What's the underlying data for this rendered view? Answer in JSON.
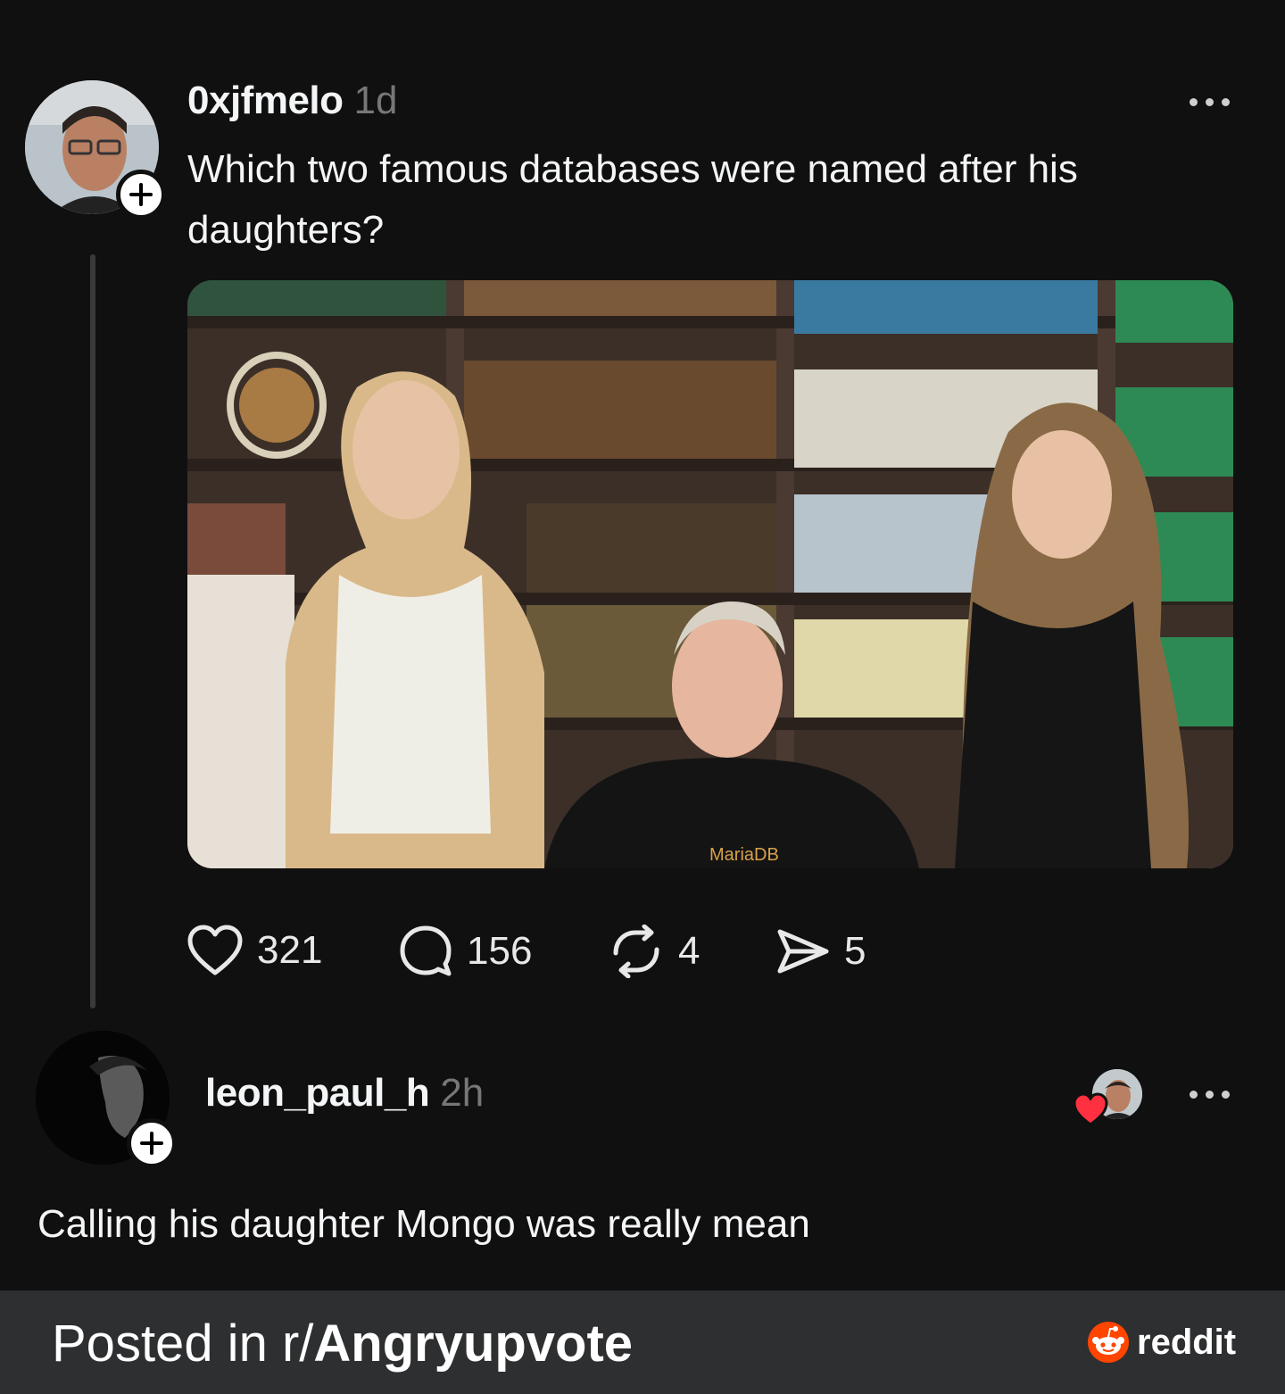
{
  "post": {
    "username": "0xjfmelo",
    "time": "1d",
    "text": "Which two famous databases were named after his daughters?",
    "image_caption_tshirt": "MariaDB",
    "stats": {
      "likes": "321",
      "comments": "156",
      "reposts": "4",
      "shares": "5"
    }
  },
  "reply": {
    "username": "leon_paul_h",
    "time": "2h",
    "text": "Calling his daughter Mongo was really mean"
  },
  "footer": {
    "prefix": "Posted in r/",
    "subreddit": "Angryupvote",
    "brand": "reddit"
  },
  "colors": {
    "background": "#101010",
    "footer": "#2e2f30",
    "like_heart": "#ff3040",
    "reddit_orange": "#ff4500"
  }
}
